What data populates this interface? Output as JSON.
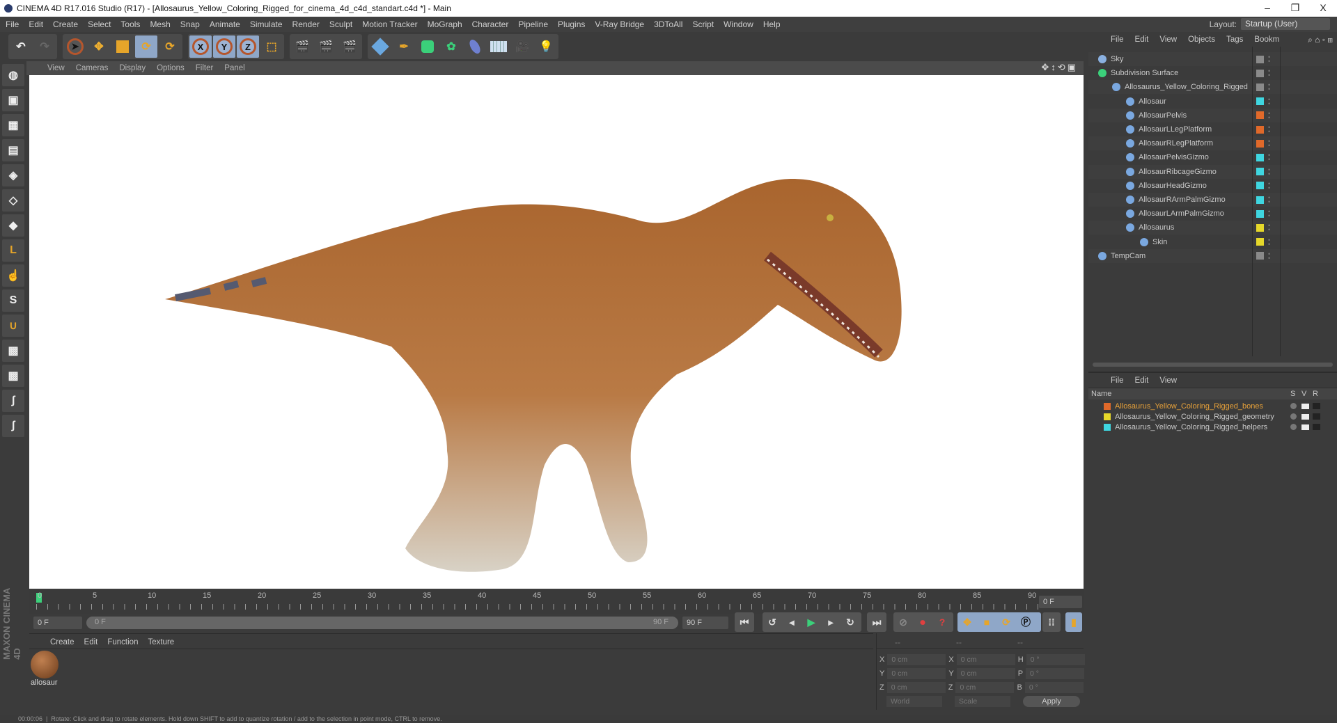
{
  "window": {
    "title": "CINEMA 4D R17.016 Studio (R17) - [Allosaurus_Yellow_Coloring_Rigged_for_cinema_4d_c4d_standart.c4d *] - Main",
    "minimize": "–",
    "restore": "❐",
    "close": "X"
  },
  "menu": [
    "File",
    "Edit",
    "Create",
    "Select",
    "Tools",
    "Mesh",
    "Snap",
    "Animate",
    "Simulate",
    "Render",
    "Sculpt",
    "Motion Tracker",
    "MoGraph",
    "Character",
    "Pipeline",
    "Plugins",
    "V-Ray Bridge",
    "3DToAll",
    "Script",
    "Window",
    "Help"
  ],
  "layout": {
    "label": "Layout:",
    "value": "Startup (User)"
  },
  "toolbar": {
    "x": "X",
    "y": "Y",
    "z": "Z"
  },
  "viewport_menu": [
    "View",
    "Cameras",
    "Display",
    "Options",
    "Filter",
    "Panel"
  ],
  "object_manager": {
    "menu": [
      "File",
      "Edit",
      "View",
      "Objects",
      "Tags",
      "Bookm"
    ],
    "objects": [
      {
        "name": "Sky",
        "indent": 0,
        "color": "#8a8a8a"
      },
      {
        "name": "Subdivision Surface",
        "indent": 0,
        "color": "#8a8a8a"
      },
      {
        "name": "Allosaurus_Yellow_Coloring_Rigged",
        "indent": 1,
        "color": "#8a8a8a"
      },
      {
        "name": "Allosaur",
        "indent": 2,
        "color": "#3fd6e0"
      },
      {
        "name": "AllosaurPelvis",
        "indent": 2,
        "color": "#e0692a"
      },
      {
        "name": "AllosaurLLegPlatform",
        "indent": 2,
        "color": "#e0692a"
      },
      {
        "name": "AllosaurRLegPlatform",
        "indent": 2,
        "color": "#e0692a"
      },
      {
        "name": "AllosaurPelvisGizmo",
        "indent": 2,
        "color": "#3fd6e0"
      },
      {
        "name": "AllosaurRibcageGizmo",
        "indent": 2,
        "color": "#3fd6e0"
      },
      {
        "name": "AllosaurHeadGizmo",
        "indent": 2,
        "color": "#3fd6e0"
      },
      {
        "name": "AllosaurRArmPalmGizmo",
        "indent": 2,
        "color": "#3fd6e0"
      },
      {
        "name": "AllosaurLArmPalmGizmo",
        "indent": 2,
        "color": "#3fd6e0"
      },
      {
        "name": "Allosaurus",
        "indent": 2,
        "color": "#e6d82a"
      },
      {
        "name": "Skin",
        "indent": 3,
        "color": "#e6d82a"
      },
      {
        "name": "TempCam",
        "indent": 0,
        "color": "#8a8a8a"
      }
    ]
  },
  "layer_manager": {
    "menu": [
      "File",
      "Edit",
      "View"
    ],
    "columns": [
      "Name",
      "S",
      "V",
      "R"
    ],
    "layers": [
      {
        "name": "Allosaurus_Yellow_Coloring_Rigged_bones",
        "color": "#e0692a",
        "text_color": "#e8a23a"
      },
      {
        "name": "Allosaurus_Yellow_Coloring_Rigged_geometry",
        "color": "#e6d82a",
        "text_color": "#c8c8c8"
      },
      {
        "name": "Allosaurus_Yellow_Coloring_Rigged_helpers",
        "color": "#3fd6e0",
        "text_color": "#c8c8c8"
      }
    ]
  },
  "timeline": {
    "ticks": [
      "0",
      "5",
      "10",
      "15",
      "20",
      "25",
      "30",
      "35",
      "40",
      "45",
      "50",
      "55",
      "60",
      "65",
      "70",
      "75",
      "80",
      "85",
      "90"
    ],
    "current_frame": "0 F",
    "start": "0 F",
    "range_start": "0 F",
    "range_end": "90 F",
    "end": "90 F"
  },
  "material_manager": {
    "menu": [
      "Create",
      "Edit",
      "Function",
      "Texture"
    ],
    "materials": [
      {
        "name": "allosaur"
      }
    ]
  },
  "coordinates": {
    "headers": [
      "--",
      "--",
      "--"
    ],
    "rows": [
      {
        "a": "X",
        "av": "0 cm",
        "b": "X",
        "bv": "0 cm",
        "c": "H",
        "cv": "0 °"
      },
      {
        "a": "Y",
        "av": "0 cm",
        "b": "Y",
        "bv": "0 cm",
        "c": "P",
        "cv": "0 °"
      },
      {
        "a": "Z",
        "av": "0 cm",
        "b": "Z",
        "bv": "0 cm",
        "c": "B",
        "cv": "0 °"
      }
    ],
    "mode": "World",
    "transform": "Scale",
    "apply": "Apply"
  },
  "brand": "MAXON CINEMA 4D",
  "status": {
    "time": "00:00:06",
    "message": "Rotate: Click and drag to rotate elements. Hold down SHIFT to add to quantize rotation / add to the selection in point mode, CTRL to remove."
  }
}
